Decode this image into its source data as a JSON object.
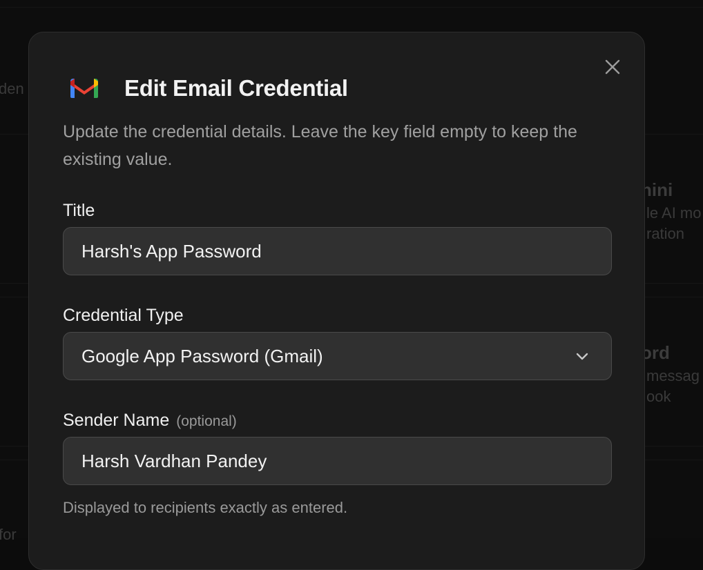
{
  "background": {
    "fragments": {
      "left_top": "den",
      "card1_title": "nini",
      "card1_line1": "le AI mo",
      "card1_line2": "ration",
      "card2_title": "ord",
      "card2_line1": "messag",
      "card2_line2": "ook",
      "left_bottom": "for"
    }
  },
  "modal": {
    "title": "Edit Email Credential",
    "description": "Update the credential details. Leave the key field empty to keep the existing value.",
    "close_icon": "close-icon",
    "brand_icon": "gmail-icon",
    "fields": {
      "title": {
        "label": "Title",
        "value": "Harsh's App Password"
      },
      "credential_type": {
        "label": "Credential Type",
        "value": "Google App Password (Gmail)"
      },
      "sender_name": {
        "label": "Sender Name",
        "optional": "(optional)",
        "value": "Harsh Vardhan Pandey",
        "helper": "Displayed to recipients exactly as entered."
      }
    }
  },
  "colors": {
    "modal_bg": "#1c1c1c",
    "field_bg": "#303030",
    "field_border": "#4a4a4a",
    "text_primary": "#f2f2f2",
    "text_secondary": "#a0a0a0",
    "gmail_red": "#EA4335",
    "gmail_blue": "#4285F4",
    "gmail_green": "#34A853",
    "gmail_yellow": "#FBBC04"
  }
}
